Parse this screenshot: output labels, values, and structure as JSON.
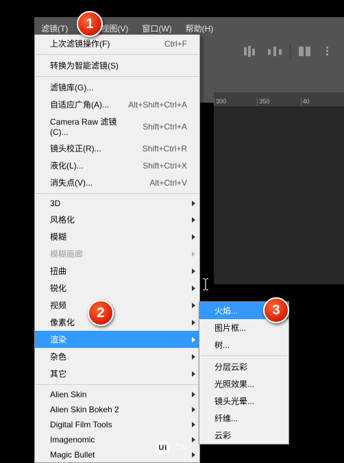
{
  "menubar": {
    "filter": "滤镜(T)",
    "view": "视图(V)",
    "window": "窗口(W)",
    "help": "帮助(H)"
  },
  "ruler": {
    "t1": "300",
    "t2": "350",
    "t3": "40"
  },
  "menu": {
    "last_filter": "上次滤镜操作(F)",
    "last_filter_sc": "Ctrl+F",
    "convert_smart": "转换为智能滤镜(S)",
    "filter_gallery": "滤镜库(G)...",
    "adaptive_wide": "自适应广角(A)...",
    "adaptive_wide_sc": "Alt+Shift+Ctrl+A",
    "camera_raw": "Camera Raw 滤镜(C)...",
    "camera_raw_sc": "Shift+Ctrl+A",
    "lens_corr": "镜头校正(R)...",
    "lens_corr_sc": "Shift+Ctrl+R",
    "liquify": "液化(L)...",
    "liquify_sc": "Shift+Ctrl+X",
    "vanishing": "消失点(V)...",
    "vanishing_sc": "Alt+Ctrl+V",
    "g3d": "3D",
    "stylize": "风格化",
    "blur": "模糊",
    "blur_gallery": "模糊画廊",
    "distort": "扭曲",
    "sharpen": "锐化",
    "video": "视频",
    "pixelate": "像素化",
    "render": "渲染",
    "noise": "杂色",
    "other": "其它",
    "alien_skin": "Alien Skin",
    "alien_skin_bokeh": "Alien Skin Bokeh 2",
    "digital_film": "Digital Film Tools",
    "imagenomic": "Imagenomic",
    "magic_bullet": "Magic Bullet"
  },
  "submenu": {
    "flame": "火焰...",
    "picture_frame": "图片框...",
    "tree": "树...",
    "clouds_diff": "分层云彩",
    "lighting": "光照效果...",
    "lens_flare": "镜头光晕...",
    "fibers": "纤维...",
    "clouds": "云彩"
  },
  "badges": {
    "b1": "1",
    "b2": "2",
    "b3": "3"
  },
  "footer": {
    "logo": "UI",
    "suffix": "·CN"
  }
}
